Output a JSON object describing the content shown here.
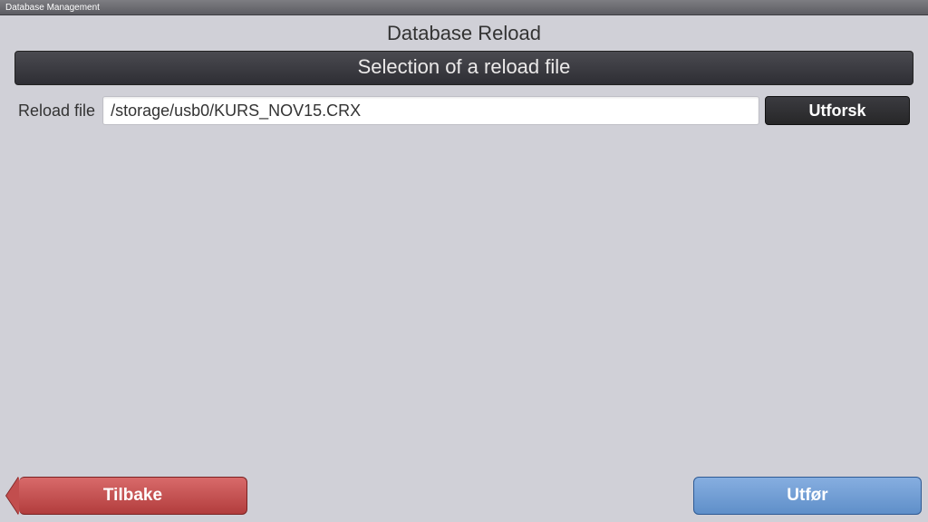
{
  "window": {
    "title": "Database Management"
  },
  "page": {
    "title": "Database Reload",
    "section_header": "Selection of a reload file"
  },
  "form": {
    "reload_file_label": "Reload file",
    "reload_file_value": "/storage/usb0/KURS_NOV15.CRX",
    "browse_label": "Utforsk"
  },
  "footer": {
    "back_label": "Tilbake",
    "execute_label": "Utfør"
  }
}
